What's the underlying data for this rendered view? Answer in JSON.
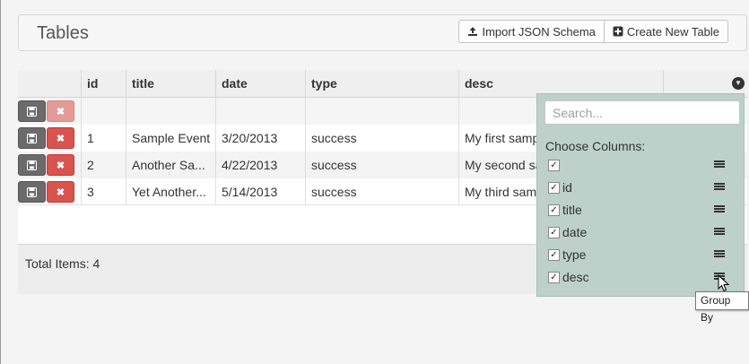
{
  "panel": {
    "title": "Tables",
    "import_label": "Import JSON Schema",
    "create_label": "Create New Table"
  },
  "grid": {
    "columns": [
      "id",
      "title",
      "date",
      "type",
      "desc"
    ],
    "rows": [
      {
        "id": "",
        "title": "",
        "date": "",
        "type": "",
        "desc": ""
      },
      {
        "id": "1",
        "title": "Sample Event",
        "date": "3/20/2013",
        "type": "success",
        "desc": "My first samp"
      },
      {
        "id": "2",
        "title": "Another Sa...",
        "date": "4/22/2013",
        "type": "success",
        "desc": "My second sa"
      },
      {
        "id": "3",
        "title": "Yet Another...",
        "date": "5/14/2013",
        "type": "success",
        "desc": "My third sam"
      }
    ],
    "footer": {
      "total_label": "Total Items: 4"
    }
  },
  "column_menu": {
    "search_placeholder": "Search...",
    "heading": "Choose Columns:",
    "items": [
      {
        "label": "",
        "checked": true
      },
      {
        "label": "id",
        "checked": true
      },
      {
        "label": "title",
        "checked": true
      },
      {
        "label": "date",
        "checked": true
      },
      {
        "label": "type",
        "checked": true
      },
      {
        "label": "desc",
        "checked": true
      }
    ]
  },
  "tooltip": "Group By",
  "icons": {
    "import": "upload-icon",
    "create": "plus-square-icon",
    "save": "floppy-disk-icon",
    "delete": "close-icon",
    "menu_toggle": "chevron-down-icon",
    "group_by": "list-icon"
  },
  "colors": {
    "delete_button": "#d9534f",
    "save_button": "#6b6b6b",
    "menu_background": "#bdd0ca"
  }
}
